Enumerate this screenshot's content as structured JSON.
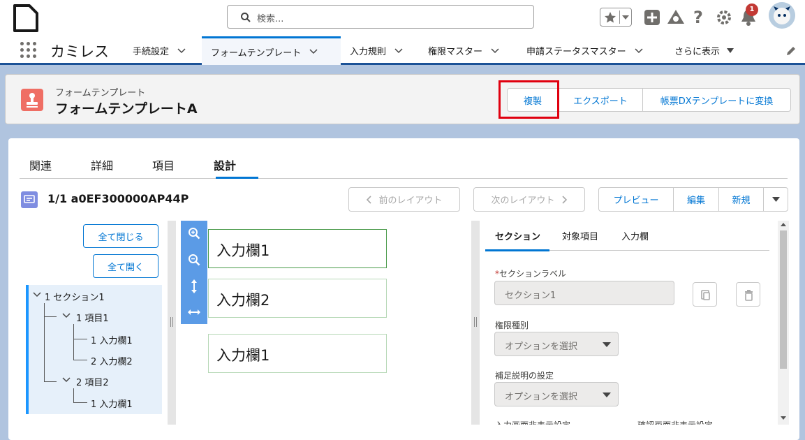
{
  "header": {
    "search_placeholder": "検索...",
    "notification_count": "1"
  },
  "nav": {
    "app_name": "カミレス",
    "items": [
      {
        "label": "手続設定"
      },
      {
        "label": "フォームテンプレート"
      },
      {
        "label": "入力規則"
      },
      {
        "label": "権限マスター"
      },
      {
        "label": "申請ステータスマスター"
      },
      {
        "label": "さらに表示"
      }
    ]
  },
  "record": {
    "object_type": "フォームテンプレート",
    "name": "フォームテンプレートA",
    "actions": {
      "duplicate": "複製",
      "export": "エクスポート",
      "convert": "帳票DXテンプレートに変換"
    }
  },
  "tabs": [
    "関連",
    "詳細",
    "項目",
    "設計"
  ],
  "designer": {
    "layout_title": "1/1 a0EF300000AP44P",
    "prev_layout": "前のレイアウト",
    "next_layout": "次のレイアウト",
    "preview": "プレビュー",
    "edit": "編集",
    "new": "新規",
    "collapse_all": "全て閉じる",
    "expand_all": "全て開く",
    "tree": [
      "1 セクション1",
      "1 項目1",
      "1 入力欄1",
      "2 入力欄2",
      "2 項目2",
      "1 入力欄1"
    ],
    "canvas_fields": [
      "入力欄1",
      "入力欄2",
      "入力欄1"
    ]
  },
  "properties": {
    "tabs": [
      "セクション",
      "対象項目",
      "入力欄"
    ],
    "section_label_label": "セクションラベル",
    "section_label_value": "セクション1",
    "permission_label": "権限種別",
    "permission_placeholder": "オプションを選択",
    "help_label": "補足説明の設定",
    "help_placeholder": "オプションを選択",
    "cut_off_1": "入力画面非表示設定",
    "cut_off_2": "確認画面非表示設定"
  }
}
